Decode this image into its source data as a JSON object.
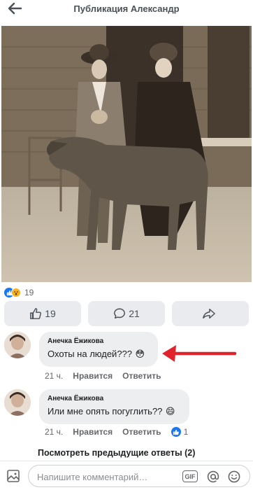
{
  "header": {
    "title": "Публикация Александр",
    "back_icon": "back-arrow-icon"
  },
  "post": {
    "reaction_count": "19"
  },
  "actions": {
    "like_count": "19",
    "comment_count": "21"
  },
  "comments": [
    {
      "author": "Анечка Ёжикова",
      "text": "Охоты на людей???",
      "emoji": "😳",
      "time": "21 ч.",
      "like_label": "Нравится",
      "reply_label": "Ответить"
    },
    {
      "author": "Анечка Ёжикова",
      "text": "Или мне опять погуглить??",
      "emoji": "😄",
      "time": "21 ч.",
      "like_label": "Нравится",
      "reply_label": "Ответить",
      "likes": "1"
    }
  ],
  "more_replies": "Посмотреть предыдущие ответы (2)",
  "composer": {
    "placeholder": "Напишите комментарий…",
    "gif_label": "GIF"
  },
  "colors": {
    "accent": "#1877f2",
    "bubble": "#edeef0",
    "arrow": "#e0242c"
  }
}
